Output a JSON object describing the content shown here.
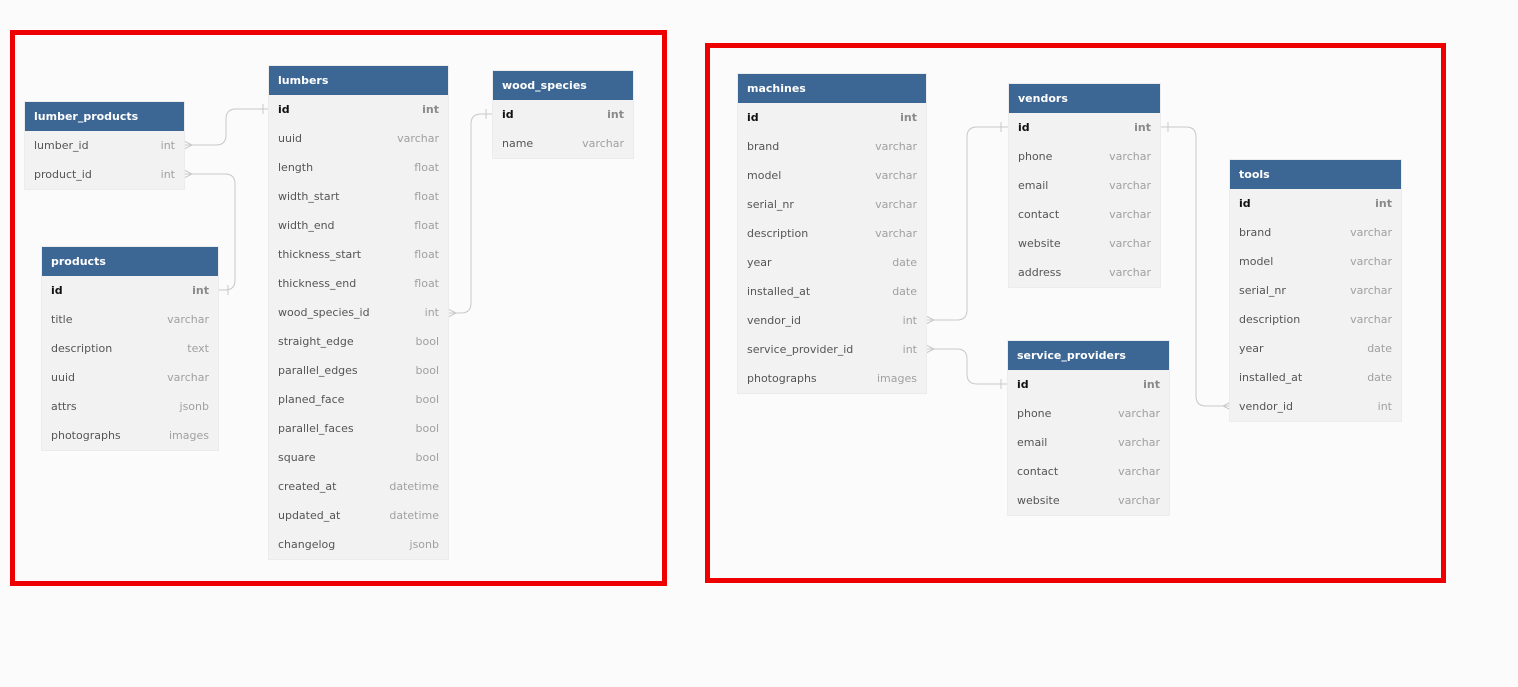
{
  "tables": {
    "lumber_products": {
      "title": "lumber_products",
      "columns": [
        {
          "name": "lumber_id",
          "type": "int"
        },
        {
          "name": "product_id",
          "type": "int"
        }
      ]
    },
    "products": {
      "title": "products",
      "columns": [
        {
          "name": "id",
          "type": "int",
          "pk": true
        },
        {
          "name": "title",
          "type": "varchar"
        },
        {
          "name": "description",
          "type": "text"
        },
        {
          "name": "uuid",
          "type": "varchar"
        },
        {
          "name": "attrs",
          "type": "jsonb"
        },
        {
          "name": "photographs",
          "type": "images"
        }
      ]
    },
    "lumbers": {
      "title": "lumbers",
      "columns": [
        {
          "name": "id",
          "type": "int",
          "pk": true
        },
        {
          "name": "uuid",
          "type": "varchar"
        },
        {
          "name": "length",
          "type": "float"
        },
        {
          "name": "width_start",
          "type": "float"
        },
        {
          "name": "width_end",
          "type": "float"
        },
        {
          "name": "thickness_start",
          "type": "float"
        },
        {
          "name": "thickness_end",
          "type": "float"
        },
        {
          "name": "wood_species_id",
          "type": "int"
        },
        {
          "name": "straight_edge",
          "type": "bool"
        },
        {
          "name": "parallel_edges",
          "type": "bool"
        },
        {
          "name": "planed_face",
          "type": "bool"
        },
        {
          "name": "parallel_faces",
          "type": "bool"
        },
        {
          "name": "square",
          "type": "bool"
        },
        {
          "name": "created_at",
          "type": "datetime"
        },
        {
          "name": "updated_at",
          "type": "datetime"
        },
        {
          "name": "changelog",
          "type": "jsonb"
        }
      ]
    },
    "wood_species": {
      "title": "wood_species",
      "columns": [
        {
          "name": "id",
          "type": "int",
          "pk": true
        },
        {
          "name": "name",
          "type": "varchar"
        }
      ]
    },
    "machines": {
      "title": "machines",
      "columns": [
        {
          "name": "id",
          "type": "int",
          "pk": true
        },
        {
          "name": "brand",
          "type": "varchar"
        },
        {
          "name": "model",
          "type": "varchar"
        },
        {
          "name": "serial_nr",
          "type": "varchar"
        },
        {
          "name": "description",
          "type": "varchar"
        },
        {
          "name": "year",
          "type": "date"
        },
        {
          "name": "installed_at",
          "type": "date"
        },
        {
          "name": "vendor_id",
          "type": "int"
        },
        {
          "name": "service_provider_id",
          "type": "int"
        },
        {
          "name": "photographs",
          "type": "images"
        }
      ]
    },
    "vendors": {
      "title": "vendors",
      "columns": [
        {
          "name": "id",
          "type": "int",
          "pk": true
        },
        {
          "name": "phone",
          "type": "varchar"
        },
        {
          "name": "email",
          "type": "varchar"
        },
        {
          "name": "contact",
          "type": "varchar"
        },
        {
          "name": "website",
          "type": "varchar"
        },
        {
          "name": "address",
          "type": "varchar"
        }
      ]
    },
    "service_providers": {
      "title": "service_providers",
      "columns": [
        {
          "name": "id",
          "type": "int",
          "pk": true
        },
        {
          "name": "phone",
          "type": "varchar"
        },
        {
          "name": "email",
          "type": "varchar"
        },
        {
          "name": "contact",
          "type": "varchar"
        },
        {
          "name": "website",
          "type": "varchar"
        }
      ]
    },
    "tools": {
      "title": "tools",
      "columns": [
        {
          "name": "id",
          "type": "int",
          "pk": true
        },
        {
          "name": "brand",
          "type": "varchar"
        },
        {
          "name": "model",
          "type": "varchar"
        },
        {
          "name": "serial_nr",
          "type": "varchar"
        },
        {
          "name": "description",
          "type": "varchar"
        },
        {
          "name": "year",
          "type": "date"
        },
        {
          "name": "installed_at",
          "type": "date"
        },
        {
          "name": "vendor_id",
          "type": "int"
        }
      ]
    }
  },
  "colors": {
    "header": "#3c6694",
    "group_border": "#ef0000",
    "row_bg": "#f2f2f2",
    "connector": "#c8c8c8"
  }
}
